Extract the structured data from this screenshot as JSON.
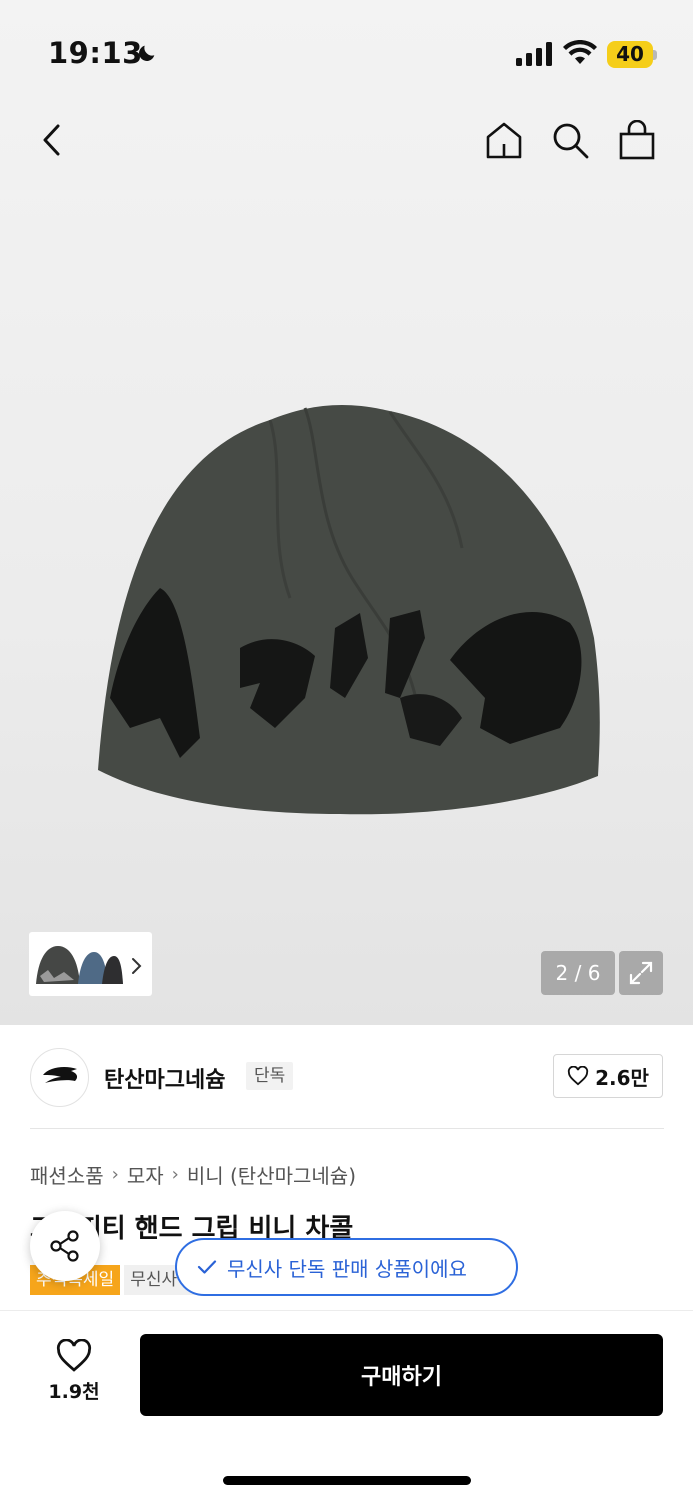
{
  "status_bar": {
    "time": "19:13",
    "battery": "40"
  },
  "header": {
    "back_icon": "chevron-left",
    "home_icon": "home",
    "search_icon": "search",
    "bag_icon": "shopping-bag"
  },
  "gallery": {
    "pager": "2 / 6",
    "expand_icon": "expand-arrows",
    "thumb_chevron": "chevron-right"
  },
  "brand": {
    "name": "탄산마그네슘",
    "badge": "단독",
    "logo_text": "tansanmagnesium",
    "likes": "2.6만"
  },
  "breadcrumb": [
    "패션소품",
    "모자",
    "비니 (탄산마그네슘)"
  ],
  "product": {
    "title": "그래피티 핸드 그립 비니 차콜",
    "tags": [
      "추석특세일",
      "무신사 단독"
    ]
  },
  "toast": {
    "text": "무신사 단독 판매 상품이에요"
  },
  "bottom_bar": {
    "wish_count": "1.9천",
    "buy_label": "구매하기"
  },
  "colors": {
    "accent_blue": "#2f6ee2",
    "sale_tag": "#f6a51b",
    "battery": "#f5ce1a",
    "buy_button": "#000000"
  }
}
